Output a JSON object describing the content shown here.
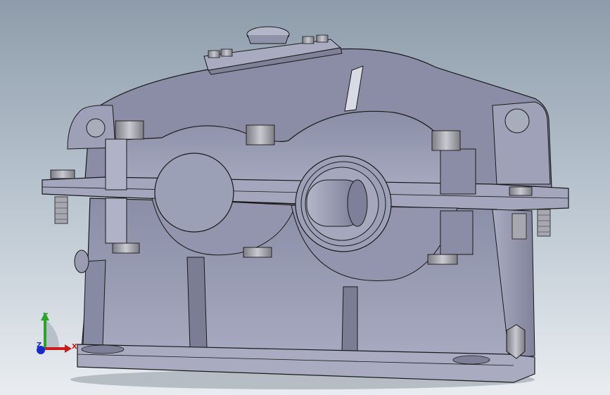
{
  "viewport": {
    "background_top": "#8e9cab",
    "background_bottom": "#e9edf1"
  },
  "model": {
    "description_icon": "gear-reducer-housing-3d-model",
    "body_color": "#8c90a8",
    "face_color": "#9fa3b9",
    "bolt_color": "#9a9aa4",
    "edge_color": "#1a1a1a"
  },
  "triad": {
    "x_label": "X",
    "y_label": "Y",
    "z_label": "Z",
    "x_color": "#cc1a1a",
    "y_color": "#2aa52a",
    "z_color": "#1a2acc"
  }
}
